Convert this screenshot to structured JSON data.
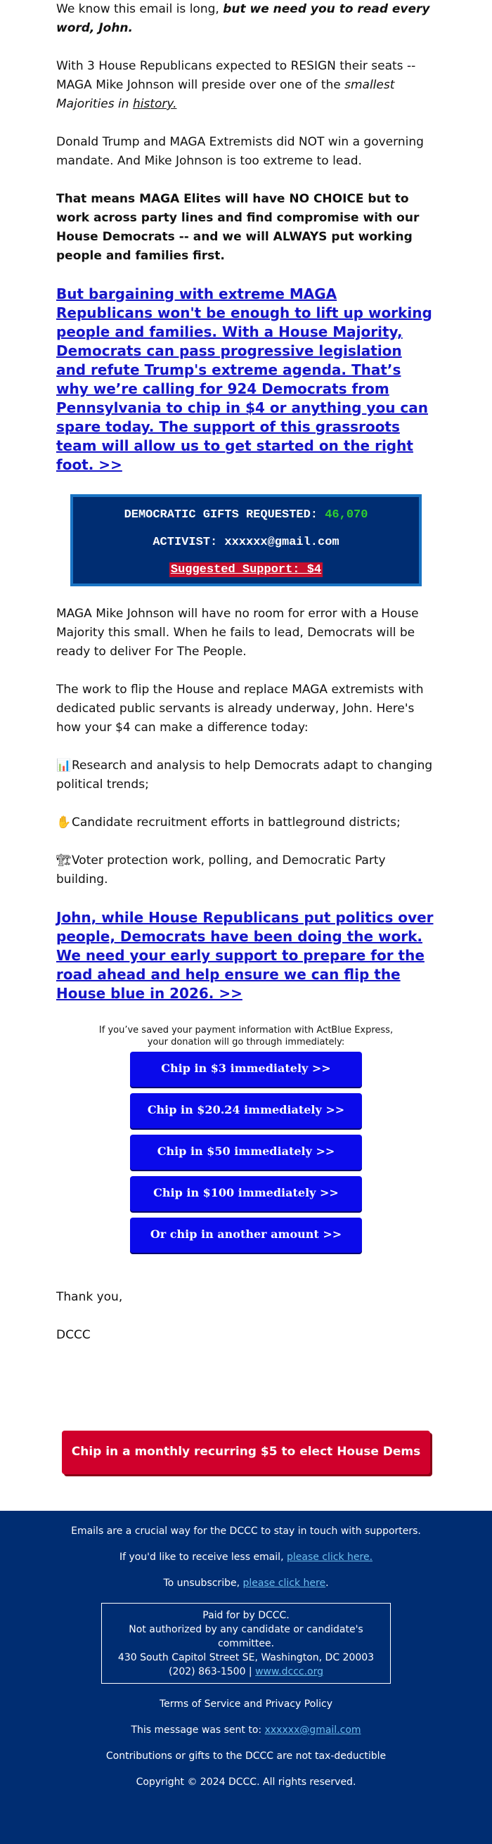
{
  "intro": {
    "lead": "We know this email is long, ",
    "lead_emphasis": "but we need you to read every word, John."
  },
  "paragraph_resign": {
    "text": "With 3 House Republicans expected to RESIGN their seats -- MAGA Mike Johnson will preside over one of the ",
    "italic": "smallest Majorities in ",
    "italic_underlined": "history."
  },
  "paragraph_mandate": "Donald Trump and MAGA Extremists did NOT win a governing mandate. And Mike Johnson is too extreme to lead.",
  "paragraph_no_choice": "That means MAGA Elites will have NO CHOICE but to work across party lines and find compromise with our House Democrats -- and we will ALWAYS put working people and families first.",
  "headline_link_1": "But bargaining with extreme MAGA Republicans won't be enough to lift up working people and families. With a House Majority, Democrats can pass progressive legislation and refute Trump's extreme agenda. That’s why we’re calling for 924 Democrats from Pennsylvania to chip in $4 or anything you can spare today. The support of this grassroots team will allow us to get started on the right foot. >>",
  "gifts_box": {
    "requested_label": "DEMOCRATIC GIFTS REQUESTED: ",
    "requested_count": "46,070",
    "activist_label": "ACTIVIST: ",
    "activist_email": "xxxxxx@gmail.com",
    "suggested_support": "Suggested Support: $4",
    "colors": {
      "background": "#002d72",
      "border": "#1a74c4",
      "count": "#2fd02f",
      "suggested_bg": "#c8102e"
    }
  },
  "paragraph_no_room": "MAGA Mike Johnson will have no room for error with a House Majority this small. When he fails to lead, Democrats will be ready to deliver For The People.",
  "paragraph_work": "The work to flip the House and replace MAGA extremists with dedicated public servants is already underway, John. Here's how your $4 can make a difference today:",
  "bullets": [
    {
      "icon": "bar-chart-icon",
      "glyph": "📊",
      "text": "Research and analysis to help Democrats adapt to changing political trends;"
    },
    {
      "icon": "raised-hand-icon",
      "glyph": "✋",
      "text": "Candidate recruitment efforts in battleground districts;"
    },
    {
      "icon": "building-construction-icon",
      "glyph": "🏗",
      "text": "Voter protection work, polling, and Democratic Party building."
    }
  ],
  "headline_link_2": "John, while House Republicans put politics over people, Democrats have been doing the work. We need your early support to prepare for the road ahead and help ensure we can flip the House blue in 2026. >>",
  "actblue_note": {
    "line1": "If you’ve saved your payment information with ActBlue Express,",
    "line2": "your donation will go through immediately:"
  },
  "donate_buttons": [
    "Chip in $3 immediately >>",
    "Chip in $20.24 immediately >>",
    "Chip in $50 immediately >>",
    "Chip in $100 immediately >>",
    "Or chip in another amount >>"
  ],
  "signoff": {
    "closing": "Thank you,",
    "signature": "DCCC"
  },
  "recurring_button": "Chip in a monthly recurring $5 to elect House Dems >>",
  "footer": {
    "crucial": "Emails are a crucial way for the DCCC to stay in touch with supporters.",
    "less_email_text": "If you'd like to receive less email, ",
    "less_email_link": "please click here.",
    "unsubscribe_text": "To unsubscribe, ",
    "unsubscribe_link": "please click here",
    "unsubscribe_tail": ".",
    "paid_for": "Paid for by DCCC.",
    "not_authorized": "Not authorized by any candidate or candidate's committee.",
    "address": "430 South Capitol Street SE, Washington, DC 20003",
    "phone": "(202) 863-1500 | ",
    "website": "www.dccc.org",
    "terms": "Terms of Service and Privacy Policy",
    "sent_to_text": "This message was sent to: ",
    "sent_to_email": "xxxxxx@gmail.com",
    "tax": "Contributions or gifts to the DCCC are not tax-deductible",
    "copyright": "Copyright © 2024 DCCC. All rights reserved.",
    "colors": {
      "background": "#002d72",
      "link": "#6fbfef"
    }
  },
  "colors": {
    "headline_link": "#1515c8",
    "donate_button": "#0a0aea",
    "recurring_button": "#d0002c"
  }
}
